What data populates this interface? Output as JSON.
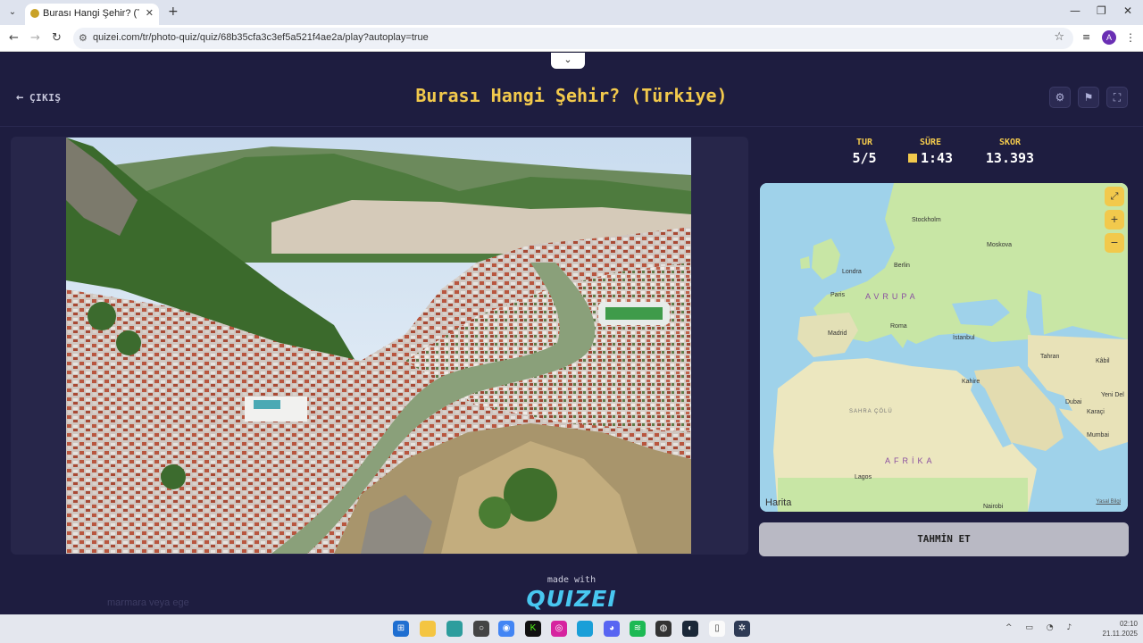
{
  "browser": {
    "tab_title": "Burası Hangi Şehir? (Türkiye) - Q",
    "url": "quizei.com/tr/photo-quiz/quiz/68b35cfa3c3ef5a521f4ae2a/play?autoplay=true",
    "profile_initial": "A"
  },
  "header": {
    "exit_label": "ÇIKIŞ",
    "title": "Burası Hangi Şehir? (Türkiye)"
  },
  "stats": {
    "round_label": "TUR",
    "round_value": "5/5",
    "time_label": "SÜRE",
    "time_value": "1:43",
    "score_label": "SKOR",
    "score_value": "13.393"
  },
  "map": {
    "labels": {
      "stockholm": "Stockholm",
      "moskova": "Moskova",
      "londra": "Londra",
      "berlin": "Berlin",
      "paris": "Paris",
      "avrupa": "AVRUPA",
      "madrid": "Madrid",
      "roma": "Roma",
      "istanbul": "İstanbul",
      "tahran": "Tahran",
      "kabil": "Kâbil",
      "kahire": "Kahire",
      "yeni_delhi": "Yeni Del",
      "dubai": "Dubai",
      "karaci": "Karaçi",
      "sahra": "SAHRA ÇÖLÜ",
      "mumbai": "Mumbai",
      "afrika": "AFRİKA",
      "lagos": "Lagos",
      "nairobi": "Nairobi"
    },
    "attribution": "Harita",
    "legal": "Yasal Bilgi"
  },
  "guess_button_label": "TAHMİN ET",
  "footer": {
    "made_with": "made with",
    "logo_text": "QUIZEI",
    "chat_text": "marmara veya ege"
  },
  "taskbar": {
    "clock_time": "02:10",
    "clock_date": "21.11.2025"
  }
}
